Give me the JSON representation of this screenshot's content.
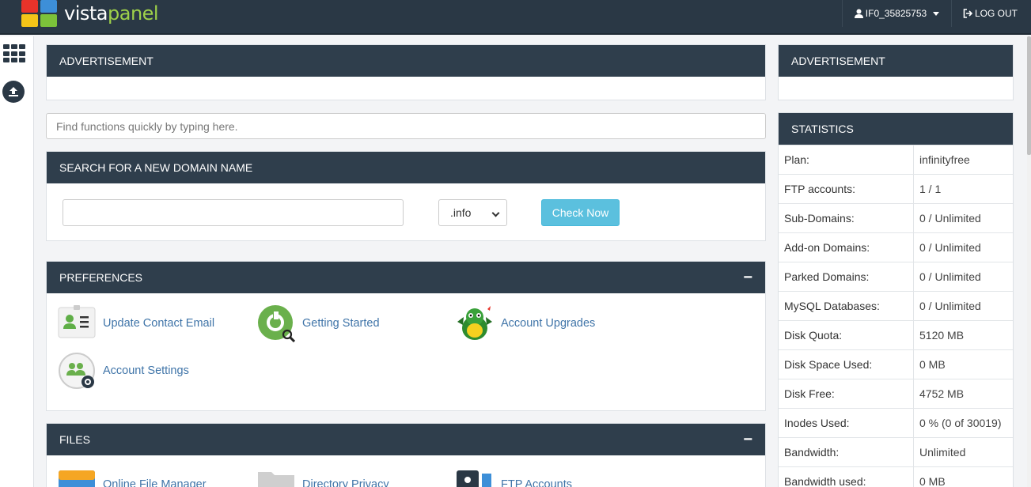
{
  "header": {
    "logo_part1": "vista",
    "logo_part2": "panel",
    "username": "IF0_35825753",
    "logout_label": "LOG OUT"
  },
  "ads": {
    "main_title": "ADVERTISEMENT",
    "side_title": "ADVERTISEMENT"
  },
  "search": {
    "placeholder": "Find functions quickly by typing here."
  },
  "domain_search": {
    "title": "SEARCH FOR A NEW DOMAIN NAME",
    "input_value": "",
    "tld_selected": ".info",
    "button_label": "Check Now"
  },
  "preferences": {
    "title": "PREFERENCES",
    "collapse_symbol": "−",
    "items": [
      {
        "label": "Update Contact Email",
        "icon": "contact-card-icon"
      },
      {
        "label": "Getting Started",
        "icon": "getting-started-icon"
      },
      {
        "label": "Account Upgrades",
        "icon": "dragon-mascot-icon"
      },
      {
        "label": "Account Settings",
        "icon": "account-settings-icon"
      }
    ]
  },
  "files": {
    "title": "FILES",
    "collapse_symbol": "−",
    "items": [
      {
        "label": "Online File Manager",
        "icon": "file-manager-icon"
      },
      {
        "label": "Directory Privacy",
        "icon": "folder-icon"
      },
      {
        "label": "FTP Accounts",
        "icon": "ftp-accounts-icon"
      }
    ]
  },
  "statistics": {
    "title": "STATISTICS",
    "rows": [
      {
        "key": "Plan:",
        "value": "infinityfree"
      },
      {
        "key": "FTP accounts:",
        "value": "1 / 1"
      },
      {
        "key": "Sub-Domains:",
        "value": "0 / Unlimited"
      },
      {
        "key": "Add-on Domains:",
        "value": "0 / Unlimited"
      },
      {
        "key": "Parked Domains:",
        "value": "0 / Unlimited"
      },
      {
        "key": "MySQL Databases:",
        "value": "0 / Unlimited"
      },
      {
        "key": "Disk Quota:",
        "value": "5120 MB"
      },
      {
        "key": "Disk Space Used:",
        "value": "0 MB"
      },
      {
        "key": "Disk Free:",
        "value": "4752 MB"
      },
      {
        "key": "Inodes Used:",
        "value": "0 % (0 of 30019)"
      },
      {
        "key": "Bandwidth:",
        "value": "Unlimited"
      },
      {
        "key": "Bandwidth used:",
        "value": "0 MB"
      }
    ]
  },
  "colors": {
    "topbar": "#2a3845",
    "panel_header": "#2f3e4c",
    "link": "#3f74a8",
    "button": "#5bc0de"
  }
}
